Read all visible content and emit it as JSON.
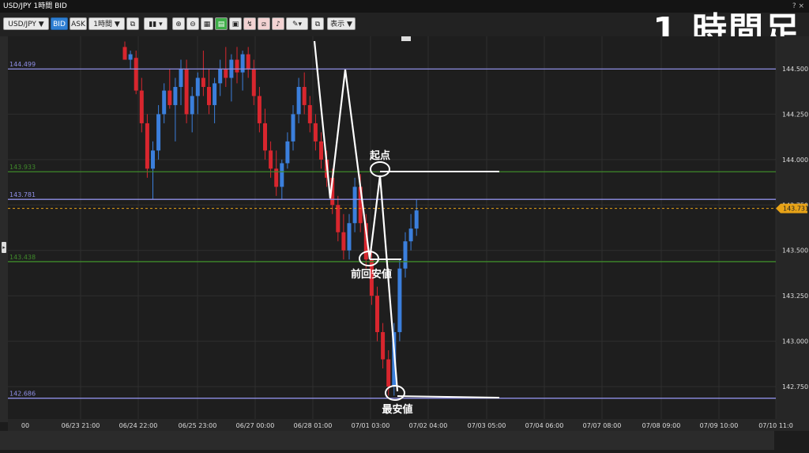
{
  "window": {
    "title": "USD/JPY 1時間 BID",
    "right_text": "? ×"
  },
  "toolbar": {
    "symbol": "USD/JPY ▼",
    "bid": "BID",
    "ask": "ASK",
    "timeframe": "1時間 ▼",
    "display": "表示 ▼"
  },
  "overlay": {
    "big_label": "1 時間足"
  },
  "annotations": {
    "start": "起点",
    "prev_low": "前回安値",
    "lowest": "最安値"
  },
  "colors": {
    "up": "#3b7fdc",
    "down": "#d8262e",
    "blue_line": "#8f8fe6",
    "green_line": "#3f8a2a",
    "current": "#e8a317"
  },
  "chart_data": {
    "type": "candlestick",
    "ylim": [
      142.6,
      144.6
    ],
    "yticks": [
      144.5,
      144.25,
      144.0,
      143.75,
      143.5,
      143.25,
      143.0,
      142.75
    ],
    "ytick_labels": [
      "144.500",
      "144.250",
      "144.000",
      "143.750",
      "143.500",
      "143.250",
      "143.000",
      "142.750"
    ],
    "xtick_labels": [
      "00",
      "06/23 21:00",
      "06/24 22:00",
      "06/25 23:00",
      "06/27 00:00",
      "06/28 01:00",
      "07/01 03:00",
      "07/02 04:00",
      "07/03 05:00",
      "07/04 06:00",
      "07/07 08:00",
      "07/08 09:00",
      "07/09 10:00",
      "07/10 11:0"
    ],
    "hlines": [
      {
        "value": 144.499,
        "label": "144.499",
        "color": "blue"
      },
      {
        "value": 143.933,
        "label": "143.933",
        "color": "green"
      },
      {
        "value": 143.781,
        "label": "143.781",
        "color": "blue"
      },
      {
        "value": 143.438,
        "label": "143.438",
        "color": "green"
      },
      {
        "value": 142.686,
        "label": "142.686",
        "color": "blue"
      }
    ],
    "current_price": {
      "value": 143.731,
      "label": "143.731"
    },
    "candles": [
      [
        144.62,
        144.65,
        144.55,
        144.55
      ],
      [
        144.55,
        144.6,
        144.5,
        144.58
      ],
      [
        144.56,
        144.6,
        144.36,
        144.38
      ],
      [
        144.38,
        144.45,
        144.15,
        144.2
      ],
      [
        144.2,
        144.25,
        143.9,
        143.95
      ],
      [
        143.95,
        144.1,
        143.78,
        144.05
      ],
      [
        144.05,
        144.3,
        144.0,
        144.25
      ],
      [
        144.25,
        144.42,
        144.2,
        144.38
      ],
      [
        144.38,
        144.5,
        144.28,
        144.3
      ],
      [
        144.3,
        144.45,
        144.1,
        144.4
      ],
      [
        144.4,
        144.55,
        144.3,
        144.5
      ],
      [
        144.5,
        144.55,
        144.2,
        144.25
      ],
      [
        144.25,
        144.4,
        144.15,
        144.35
      ],
      [
        144.35,
        144.48,
        144.25,
        144.45
      ],
      [
        144.45,
        144.6,
        144.35,
        144.4
      ],
      [
        144.4,
        144.5,
        144.25,
        144.3
      ],
      [
        144.3,
        144.45,
        144.2,
        144.42
      ],
      [
        144.42,
        144.55,
        144.35,
        144.5
      ],
      [
        144.5,
        144.62,
        144.4,
        144.45
      ],
      [
        144.45,
        144.58,
        144.32,
        144.55
      ],
      [
        144.55,
        144.62,
        144.42,
        144.48
      ],
      [
        144.48,
        144.6,
        144.38,
        144.58
      ],
      [
        144.58,
        144.62,
        144.45,
        144.5
      ],
      [
        144.5,
        144.55,
        144.3,
        144.35
      ],
      [
        144.35,
        144.4,
        144.15,
        144.2
      ],
      [
        144.2,
        144.28,
        144.0,
        144.05
      ],
      [
        144.05,
        144.1,
        143.9,
        143.95
      ],
      [
        143.95,
        144.05,
        143.8,
        143.85
      ],
      [
        143.85,
        144.0,
        143.78,
        143.98
      ],
      [
        143.98,
        144.15,
        143.95,
        144.1
      ],
      [
        144.1,
        144.3,
        144.05,
        144.25
      ],
      [
        144.25,
        144.45,
        144.2,
        144.4
      ],
      [
        144.4,
        144.48,
        144.25,
        144.3
      ],
      [
        144.3,
        144.35,
        144.15,
        144.2
      ],
      [
        144.2,
        144.25,
        144.05,
        144.1
      ],
      [
        144.1,
        144.15,
        143.95,
        144.0
      ],
      [
        144.0,
        144.05,
        143.85,
        143.9
      ],
      [
        143.9,
        143.95,
        143.7,
        143.75
      ],
      [
        143.75,
        143.8,
        143.55,
        143.6
      ],
      [
        143.6,
        143.7,
        143.45,
        143.5
      ],
      [
        143.5,
        143.7,
        143.45,
        143.65
      ],
      [
        143.65,
        143.9,
        143.6,
        143.85
      ],
      [
        143.85,
        143.92,
        143.6,
        143.65
      ],
      [
        143.65,
        143.7,
        143.4,
        143.45
      ],
      [
        143.45,
        143.5,
        143.2,
        143.25
      ],
      [
        143.25,
        143.3,
        143.0,
        143.05
      ],
      [
        143.05,
        143.1,
        142.85,
        142.9
      ],
      [
        142.9,
        142.95,
        142.7,
        142.75
      ],
      [
        142.75,
        143.1,
        142.7,
        143.05
      ],
      [
        143.05,
        143.45,
        143.0,
        143.4
      ],
      [
        143.4,
        143.6,
        143.35,
        143.55
      ],
      [
        143.55,
        143.7,
        143.5,
        143.62
      ],
      [
        143.62,
        143.78,
        143.58,
        143.72
      ]
    ]
  }
}
